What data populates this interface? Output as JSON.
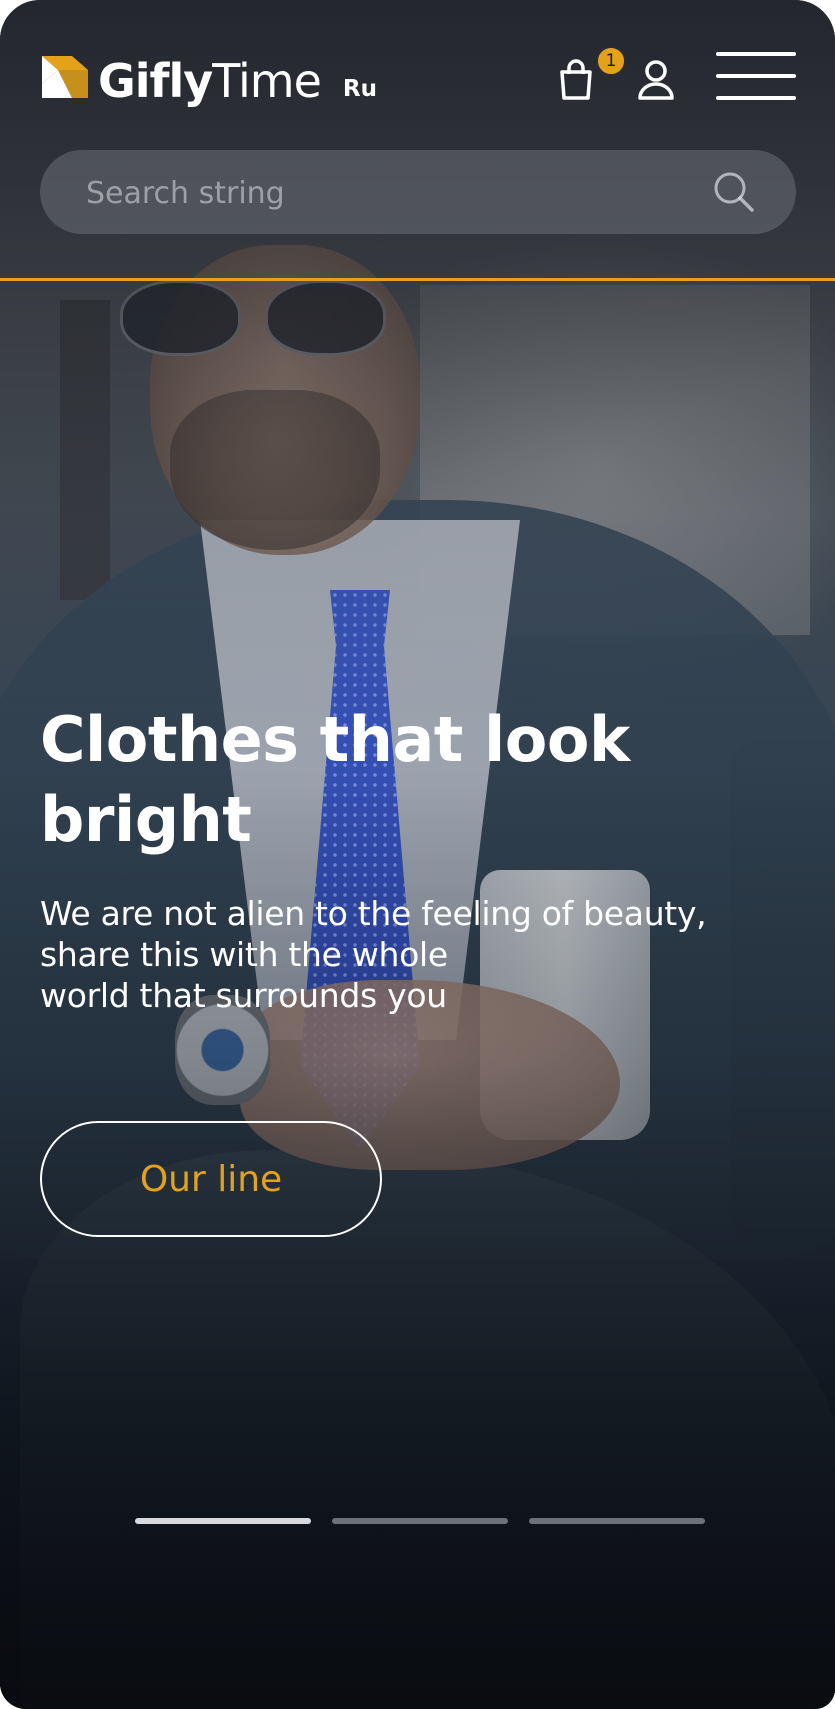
{
  "header": {
    "logo_bold": "Gifly",
    "logo_regular": "Time",
    "locale": "Ru",
    "cart_count": "1"
  },
  "search": {
    "placeholder": "Search string"
  },
  "hero": {
    "title": "Clothes that look bright",
    "subtitle_lines": [
      "We are not alien to the feeling of beauty,",
      "share this with the whole",
      "world that surrounds you"
    ],
    "cta_label": "Our line"
  },
  "slider": {
    "count": 3,
    "active_index": 0
  },
  "colors": {
    "accent": "#e3a21a",
    "text": "#ffffff",
    "background": "#1d232c"
  },
  "icons": {
    "logo": "logo-mark-icon",
    "cart": "shopping-bag-icon",
    "user": "user-icon",
    "menu": "hamburger-menu-icon",
    "search": "search-icon"
  }
}
